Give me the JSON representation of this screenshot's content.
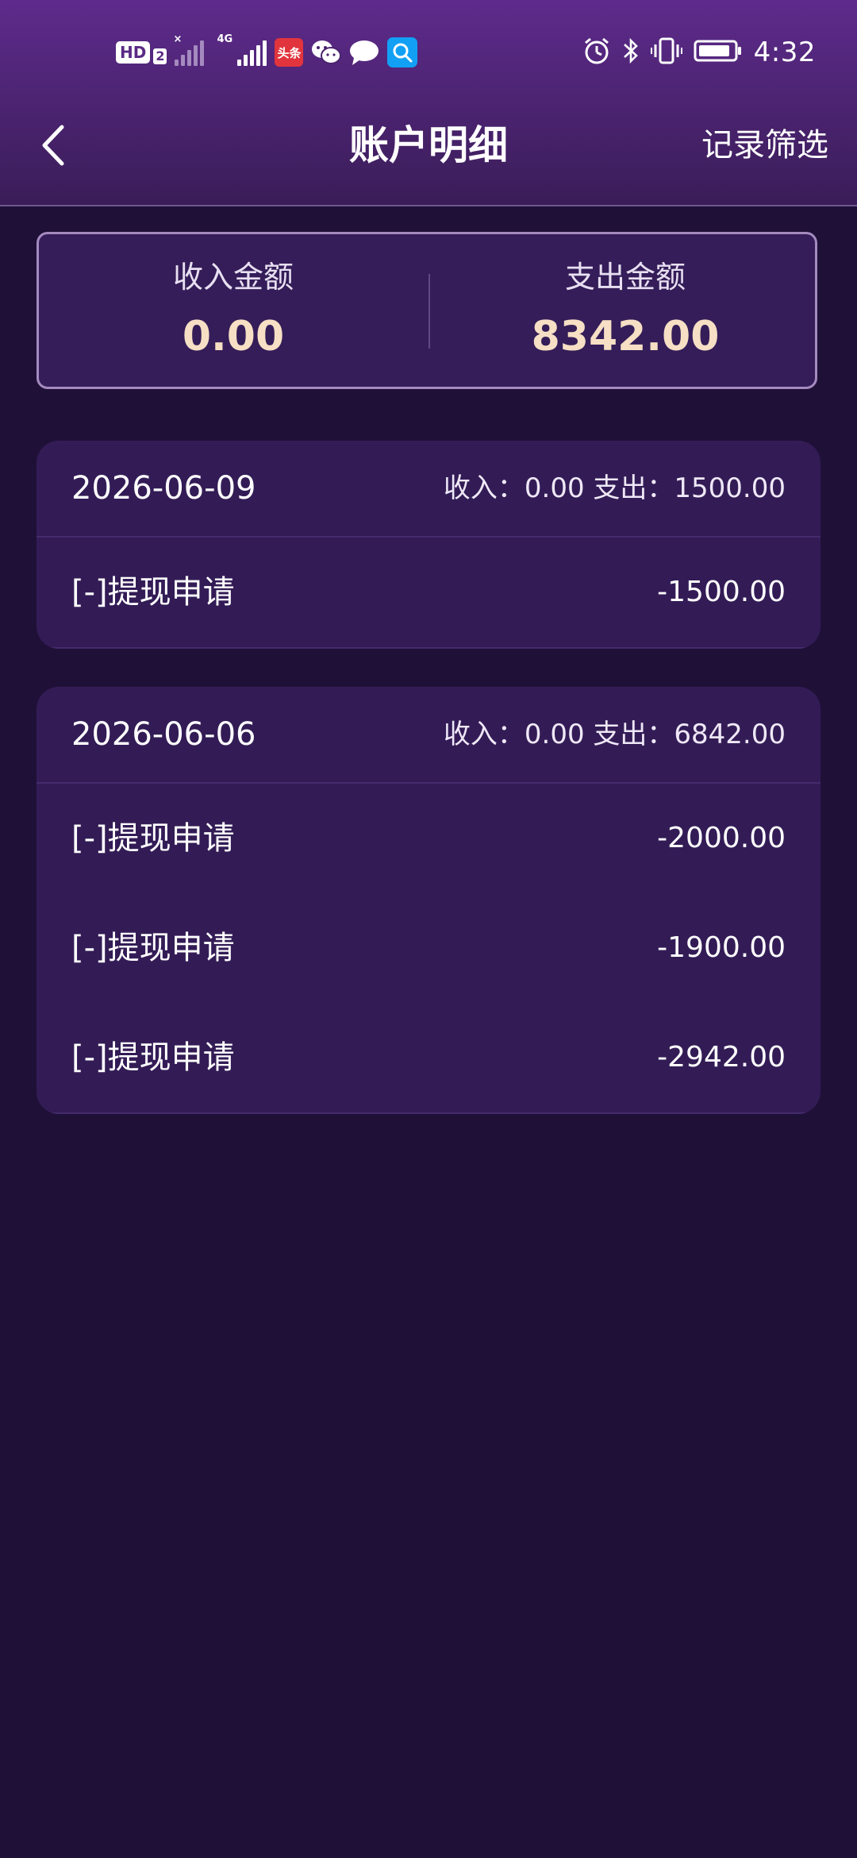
{
  "status_bar": {
    "hd_label": "HD",
    "hd_sub": "2",
    "net_label": "4G",
    "toutiao_label": "头条",
    "time": "4:32"
  },
  "nav": {
    "title": "账户明细",
    "filter_label": "记录筛选"
  },
  "summary": {
    "income_label": "收入金额",
    "income_value": "0.00",
    "expense_label": "支出金额",
    "expense_value": "8342.00"
  },
  "groups": [
    {
      "date": "2026-06-09",
      "summary": "收入：0.00 支出：1500.00",
      "items": [
        {
          "name": "[-]提现申请",
          "amount": "-1500.00"
        }
      ]
    },
    {
      "date": "2026-06-06",
      "summary": "收入：0.00 支出：6842.00",
      "items": [
        {
          "name": "[-]提现申请",
          "amount": "-2000.00"
        },
        {
          "name": "[-]提现申请",
          "amount": "-1900.00"
        },
        {
          "name": "[-]提现申请",
          "amount": "-2942.00"
        }
      ]
    }
  ],
  "colors": {
    "background": "#1f1038",
    "header_top": "#5e2b8c",
    "card": "#331c56",
    "accent_value": "#f6dfc4",
    "summary_border": "#a48abf"
  }
}
